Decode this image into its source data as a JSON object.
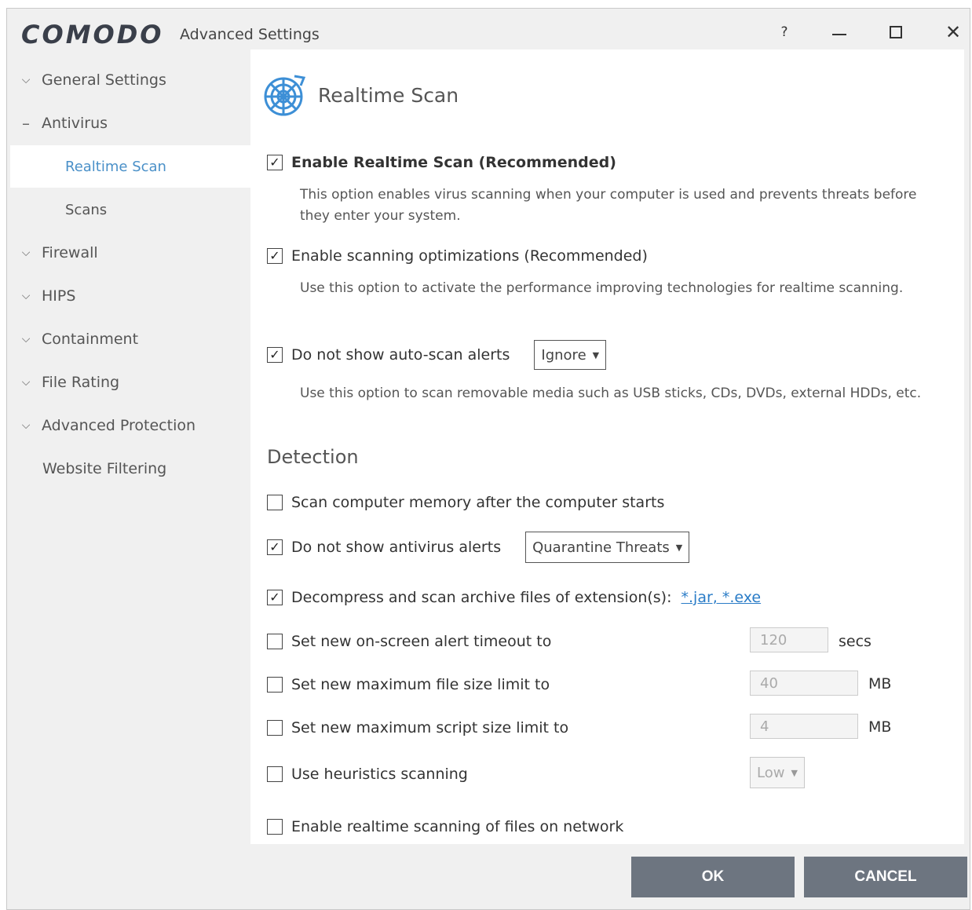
{
  "window": {
    "logo": "COMODO",
    "title": "Advanced Settings",
    "help": "?"
  },
  "sidebar": {
    "items": [
      {
        "label": "General Settings"
      },
      {
        "label": "Antivirus"
      },
      {
        "label": "Realtime Scan"
      },
      {
        "label": "Scans"
      },
      {
        "label": "Firewall"
      },
      {
        "label": "HIPS"
      },
      {
        "label": "Containment"
      },
      {
        "label": "File Rating"
      },
      {
        "label": "Advanced Protection"
      },
      {
        "label": "Website Filtering"
      }
    ]
  },
  "main": {
    "title": "Realtime Scan",
    "options": [
      {
        "label": "Enable Realtime Scan (Recommended)",
        "checked": true,
        "desc": "This option enables virus scanning when your computer is used and prevents threats before they enter your system."
      },
      {
        "label": "Enable scanning optimizations (Recommended)",
        "checked": true,
        "desc": "Use this option to activate the performance improving technologies for realtime scanning."
      },
      {
        "label": "Do not show auto-scan alerts",
        "checked": true,
        "select": "Ignore",
        "desc": "Use this option to scan removable media such as USB sticks, CDs, DVDs, external HDDs, etc."
      }
    ],
    "detection": {
      "heading": "Detection",
      "scan_memory": {
        "label": "Scan computer memory after the computer starts",
        "checked": false
      },
      "no_av_alerts": {
        "label": "Do not show antivirus alerts",
        "checked": true,
        "select": "Quarantine Threats"
      },
      "decompress": {
        "label": "Decompress and scan archive files of extension(s):",
        "checked": true,
        "link": "*.jar, *.exe"
      },
      "alert_timeout": {
        "label": "Set new on-screen alert timeout to",
        "checked": false,
        "value": "120",
        "unit": "secs"
      },
      "max_file": {
        "label": "Set new maximum file size limit to",
        "checked": false,
        "value": "40",
        "unit": "MB"
      },
      "max_script": {
        "label": "Set new maximum script size limit to",
        "checked": false,
        "value": "4",
        "unit": "MB"
      },
      "heuristics": {
        "label": "Use heuristics scanning",
        "checked": false,
        "select": "Low"
      },
      "network": {
        "label": "Enable realtime scanning of files on network",
        "checked": false
      }
    }
  },
  "footer": {
    "ok": "OK",
    "cancel": "CANCEL"
  },
  "check_mark": "✓"
}
